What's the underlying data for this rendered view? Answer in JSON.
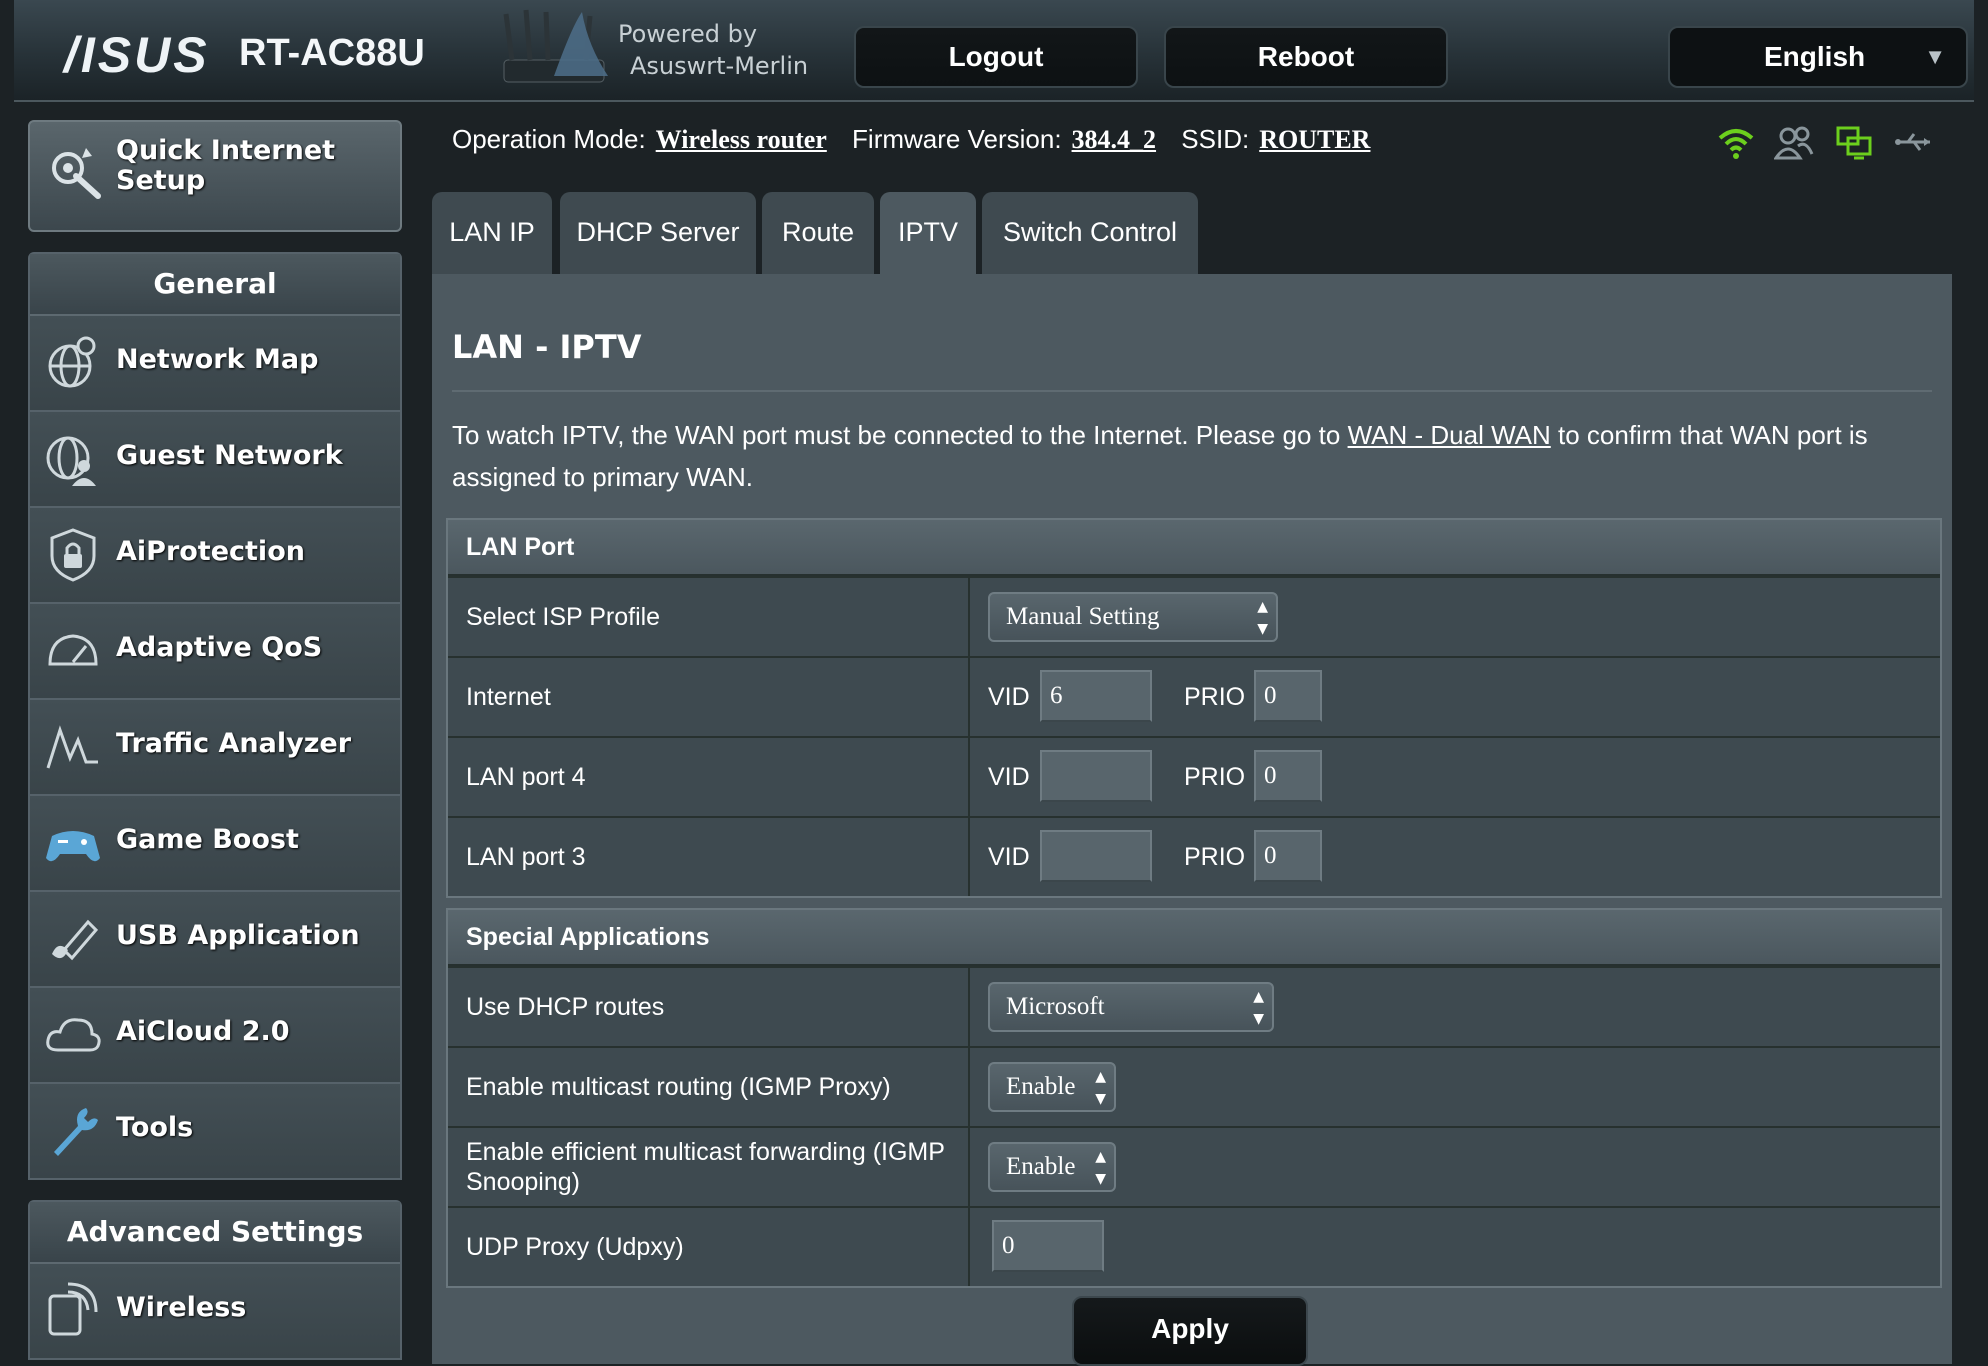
{
  "header": {
    "brand": "/ISUS",
    "model": "RT-AC88U",
    "powered_line1": "Powered by",
    "powered_line2": "Asuswrt-Merlin",
    "logout_label": "Logout",
    "reboot_label": "Reboot",
    "language": "English"
  },
  "sidebar": {
    "quick_setup_line1": "Quick Internet",
    "quick_setup_line2": "Setup",
    "general_heading": "General",
    "general_items": [
      {
        "label": "Network Map",
        "icon": "network-map-icon"
      },
      {
        "label": "Guest Network",
        "icon": "guest-network-icon"
      },
      {
        "label": "AiProtection",
        "icon": "aiprotection-icon"
      },
      {
        "label": "Adaptive QoS",
        "icon": "adaptive-qos-icon"
      },
      {
        "label": "Traffic Analyzer",
        "icon": "traffic-analyzer-icon"
      },
      {
        "label": "Game Boost",
        "icon": "game-boost-icon"
      },
      {
        "label": "USB Application",
        "icon": "usb-application-icon"
      },
      {
        "label": "AiCloud 2.0",
        "icon": "aicloud-icon"
      },
      {
        "label": "Tools",
        "icon": "tools-icon"
      }
    ],
    "advanced_heading": "Advanced Settings",
    "advanced_items": [
      {
        "label": "Wireless",
        "icon": "wireless-icon"
      }
    ]
  },
  "info": {
    "op_mode_label": "Operation Mode:",
    "op_mode_value": "Wireless router",
    "firmware_label": "Firmware Version:",
    "firmware_value": "384.4_2",
    "ssid_label": "SSID:",
    "ssid_value": "ROUTER"
  },
  "tabs": [
    {
      "label": "LAN IP"
    },
    {
      "label": "DHCP Server"
    },
    {
      "label": "Route"
    },
    {
      "label": "IPTV"
    },
    {
      "label": "Switch Control"
    }
  ],
  "active_tab": "IPTV",
  "page": {
    "title": "LAN - IPTV",
    "desc_before": "To watch IPTV, the WAN port must be connected to the Internet. Please go to ",
    "desc_link": "WAN - Dual WAN",
    "desc_after": " to confirm that WAN port is assigned to primary WAN."
  },
  "lan_port": {
    "heading": "LAN Port",
    "isp_profile_label": "Select ISP Profile",
    "isp_profile_value": "Manual Setting",
    "vid_label": "VID",
    "prio_label": "PRIO",
    "rows": [
      {
        "label": "Internet",
        "vid": "6",
        "prio": "0"
      },
      {
        "label": "LAN port 4",
        "vid": "",
        "prio": "0"
      },
      {
        "label": "LAN port 3",
        "vid": "",
        "prio": "0"
      }
    ]
  },
  "special": {
    "heading": "Special Applications",
    "dhcp_routes_label": "Use DHCP routes",
    "dhcp_routes_value": "Microsoft",
    "igmp_proxy_label": "Enable multicast routing (IGMP Proxy)",
    "igmp_proxy_value": "Enable",
    "igmp_snoop_label": "Enable efficient multicast forwarding (IGMP Snooping)",
    "igmp_snoop_value": "Enable",
    "udpxy_label": "UDP Proxy (Udpxy)",
    "udpxy_value": "0"
  },
  "apply_label": "Apply",
  "colors": {
    "panel": "#4d5960",
    "section_head": "#5a676e",
    "wifi_status": "#6ccf1d",
    "usb_status": "#8a969c"
  }
}
